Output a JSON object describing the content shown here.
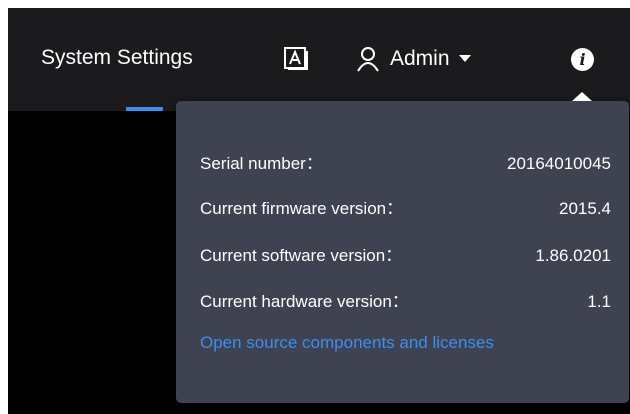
{
  "header": {
    "nav_title": "System Settings",
    "user_name": "Admin",
    "accent_color": "#3a8ff0",
    "icons": {
      "document": "document-a-icon",
      "user": "user-icon",
      "dropdown": "caret-down-icon",
      "info": "info-icon"
    },
    "info_icon_glyph": "i"
  },
  "info_popover": {
    "rows": [
      {
        "label": "Serial number：",
        "value": "20164010045"
      },
      {
        "label": "Current firmware version：",
        "value": "2015.4"
      },
      {
        "label": "Current software version：",
        "value": "1.86.0201"
      },
      {
        "label": "Current hardware version：",
        "value": "1.1"
      }
    ],
    "link_text": "Open source components and licenses"
  }
}
